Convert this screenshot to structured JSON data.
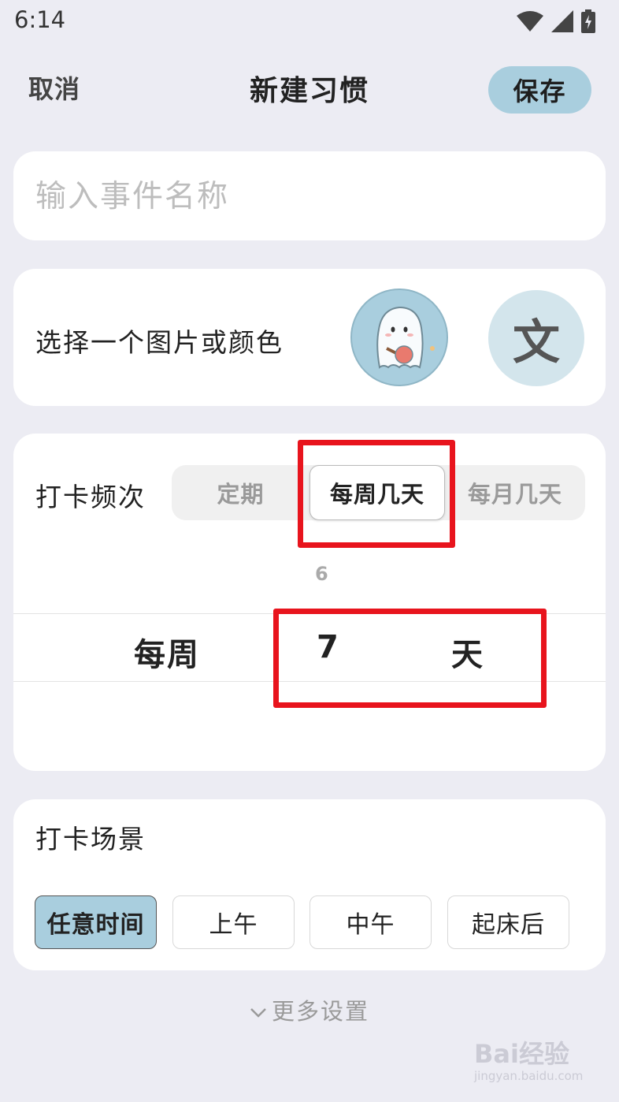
{
  "status_bar": {
    "time": "6:14",
    "icons": [
      "wifi-icon",
      "signal-icon",
      "battery-charging-icon"
    ]
  },
  "nav": {
    "cancel_label": "取消",
    "title": "新建习惯",
    "save_label": "保存"
  },
  "name_field": {
    "placeholder": "输入事件名称",
    "value": ""
  },
  "appearance": {
    "label": "选择一个图片或颜色",
    "text_option": "文"
  },
  "frequency": {
    "label": "打卡频次",
    "options": [
      "定期",
      "每周几天",
      "每月几天"
    ],
    "selected": "每周几天",
    "wheel": {
      "prefix": "每周",
      "previous_value": "6",
      "selected_value": "7",
      "unit": "天"
    }
  },
  "scene": {
    "label": "打卡场景",
    "options": [
      "任意时间",
      "上午",
      "中午",
      "起床后"
    ],
    "selected": "任意时间"
  },
  "more_settings": {
    "label": "更多设置"
  },
  "watermark": {
    "main": "Bai经验",
    "sub": "jingyan.baidu.com"
  },
  "colors": {
    "accent": "#a9cede",
    "highlight_box": "#e8141d",
    "background": "#ececf3"
  }
}
